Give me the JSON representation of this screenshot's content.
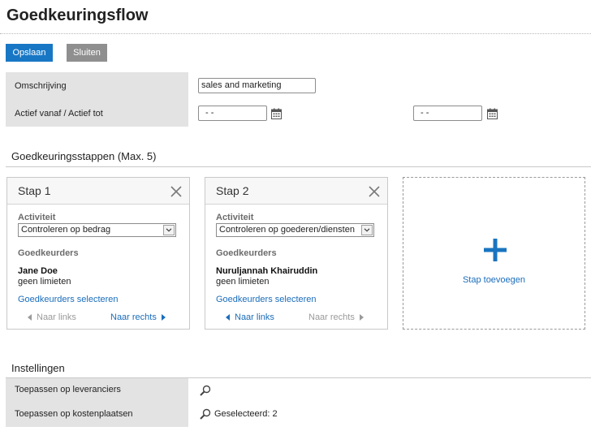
{
  "header": {
    "title": "Goedkeuringsflow"
  },
  "toolbar": {
    "save_label": "Opslaan",
    "close_label": "Sluiten"
  },
  "form": {
    "description_label": "Omschrijving",
    "description_value": "sales and marketing",
    "active_label": "Actief vanaf / Actief tot",
    "active_from_value": "- -",
    "active_to_value": "- -"
  },
  "steps_section": {
    "title": "Goedkeuringsstappen (Max. 5)",
    "activity_label": "Activiteit",
    "approvers_label": "Goedkeurders",
    "select_approvers_label": "Goedkeurders selecteren",
    "nav_left_label": "Naar links",
    "nav_right_label": "Naar rechts",
    "steps": [
      {
        "name": "Stap 1",
        "activity": "Controleren op bedrag",
        "approver": "Jane Doe",
        "limit": "geen limieten"
      },
      {
        "name": "Stap 2",
        "activity": "Controleren op goederen/diensten",
        "approver": "Nuruljannah Khairuddin",
        "limit": "geen limieten"
      }
    ],
    "add_step_label": "Stap toevoegen"
  },
  "settings": {
    "title": "Instellingen",
    "suppliers_label": "Toepassen op leveranciers",
    "costcenters_label": "Toepassen op kostenplaatsen",
    "costcenters_selected": "Geselecteerd: 2"
  },
  "colors": {
    "primary": "#1877c5",
    "secondary_button": "#8f8f8f",
    "link": "#1a6dbb",
    "label_bg": "#e3e3e3"
  },
  "icons": [
    "calendar-icon",
    "close-icon",
    "chevron-down-icon",
    "plus-icon",
    "magnifier-icon",
    "arrow-left-icon",
    "arrow-right-icon"
  ]
}
